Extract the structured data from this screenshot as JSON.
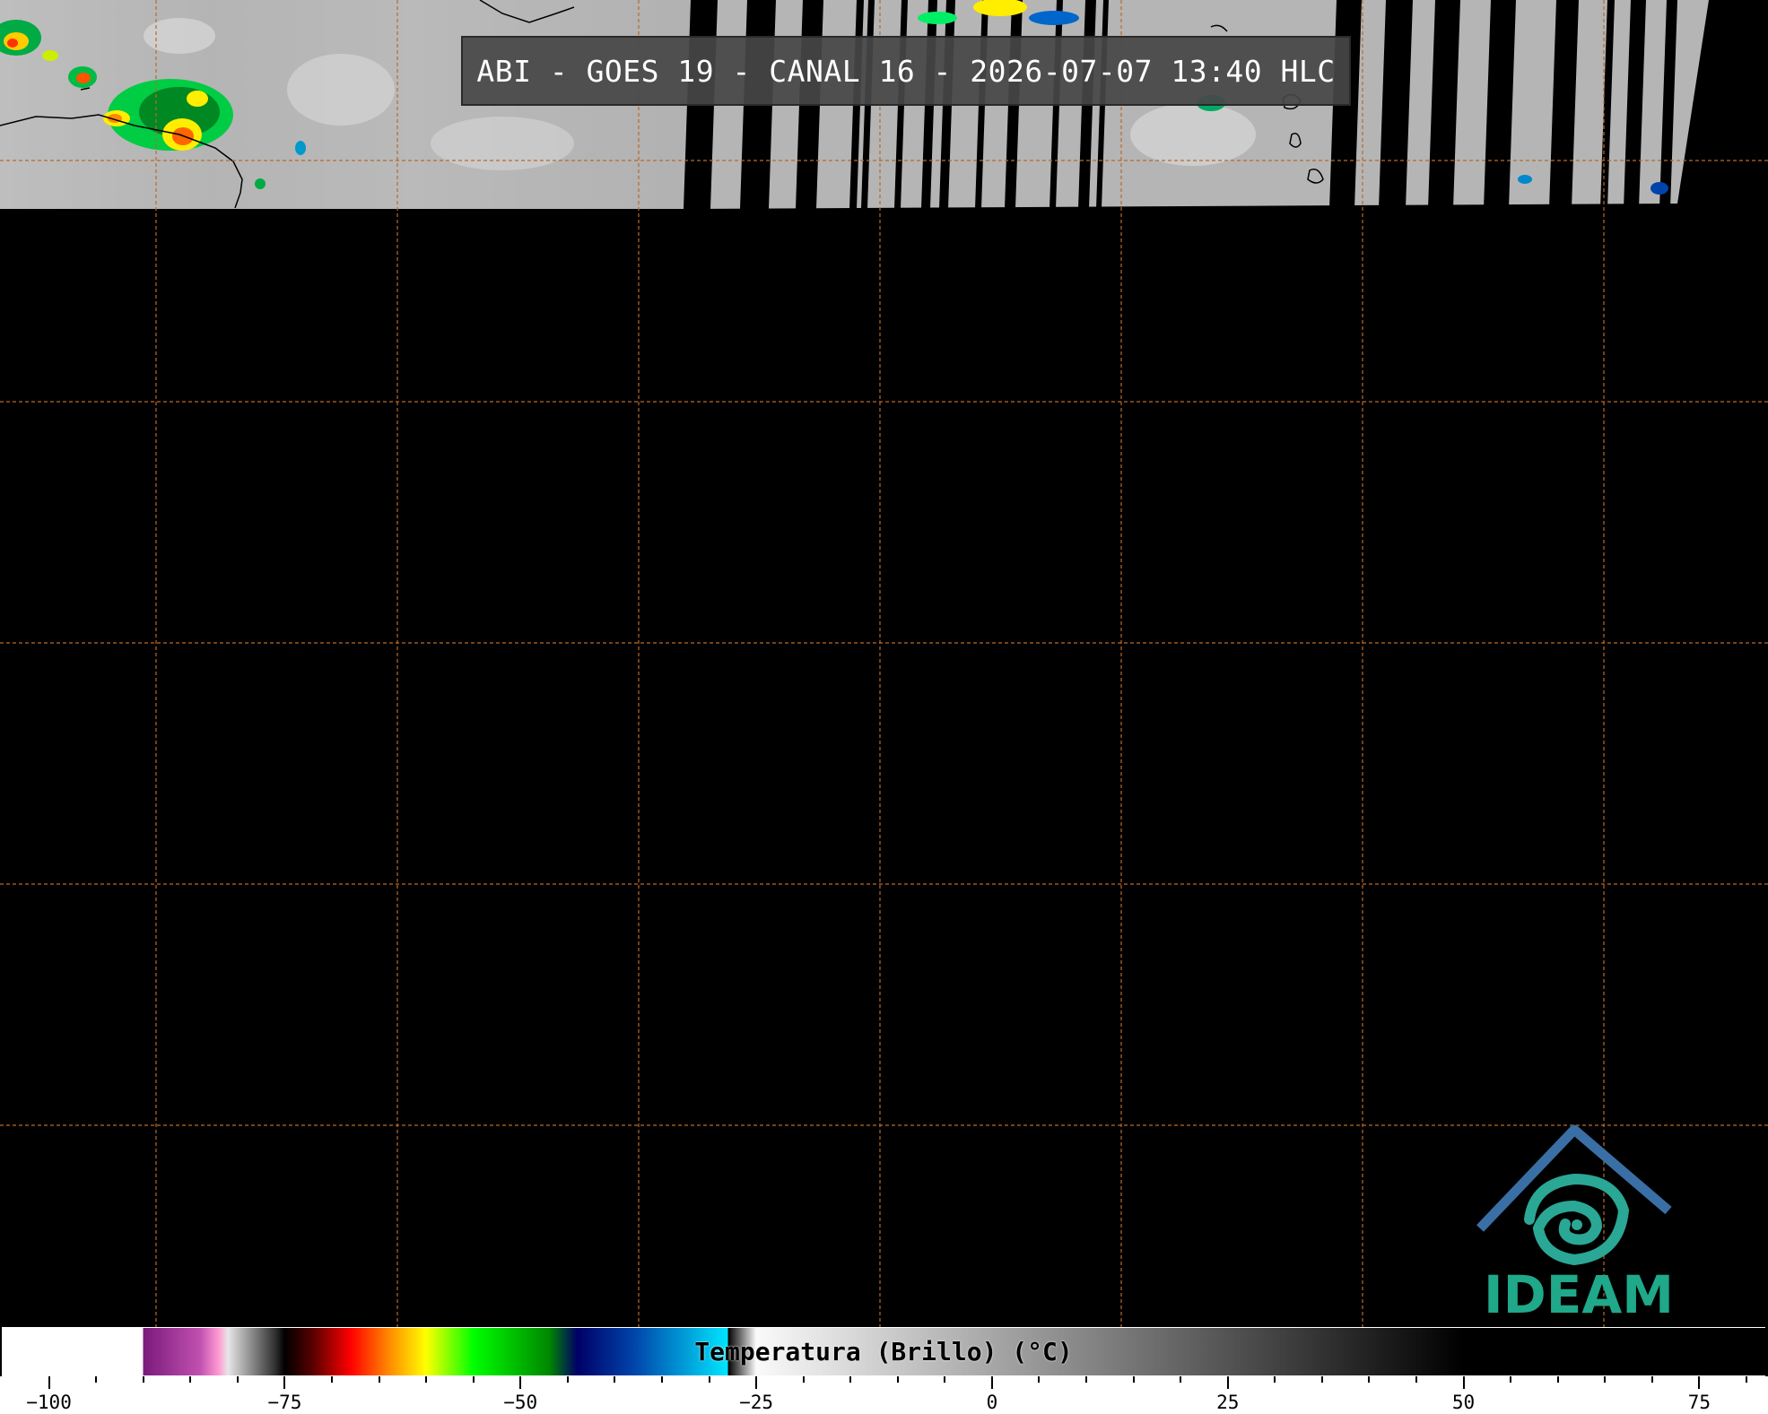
{
  "title": "ABI - GOES 19 - CANAL 16 - 2026-07-07 13:40 HLC",
  "logo": {
    "name": "IDEAM"
  },
  "colorbar": {
    "label": "Temperatura (Brillo) (°C)",
    "min": -105,
    "max": 82,
    "major_ticks": [
      -100,
      -75,
      -50,
      -25,
      0,
      25,
      50,
      75
    ],
    "major_tick_labels": [
      "−100",
      "−75",
      "−50",
      "−25",
      "0",
      "25",
      "50",
      "75"
    ],
    "minor_step": 5,
    "color_stops": [
      {
        "t": -105,
        "c": "#ffffff"
      },
      {
        "t": -90,
        "c": "#ffffff"
      },
      {
        "t": -90,
        "c": "#7a1a7a"
      },
      {
        "t": -84,
        "c": "#c050b0"
      },
      {
        "t": -82,
        "c": "#ff9ad2"
      },
      {
        "t": -81,
        "c": "#e6e6e6"
      },
      {
        "t": -76,
        "c": "#303030"
      },
      {
        "t": -75,
        "c": "#000000"
      },
      {
        "t": -72,
        "c": "#5a0000"
      },
      {
        "t": -68,
        "c": "#ff0000"
      },
      {
        "t": -64,
        "c": "#ff8800"
      },
      {
        "t": -60,
        "c": "#ffff00"
      },
      {
        "t": -55,
        "c": "#00ff00"
      },
      {
        "t": -47,
        "c": "#008800"
      },
      {
        "t": -44,
        "c": "#000066"
      },
      {
        "t": -38,
        "c": "#0044aa"
      },
      {
        "t": -28,
        "c": "#00e6ff"
      },
      {
        "t": -28,
        "c": "#000000"
      },
      {
        "t": -25,
        "c": "#fafafa"
      },
      {
        "t": 50,
        "c": "#000000"
      },
      {
        "t": 82,
        "c": "#000000"
      }
    ]
  },
  "map": {
    "graticule_color": "#b86a2a",
    "land_border_color": "#000000",
    "background": "#000000"
  }
}
